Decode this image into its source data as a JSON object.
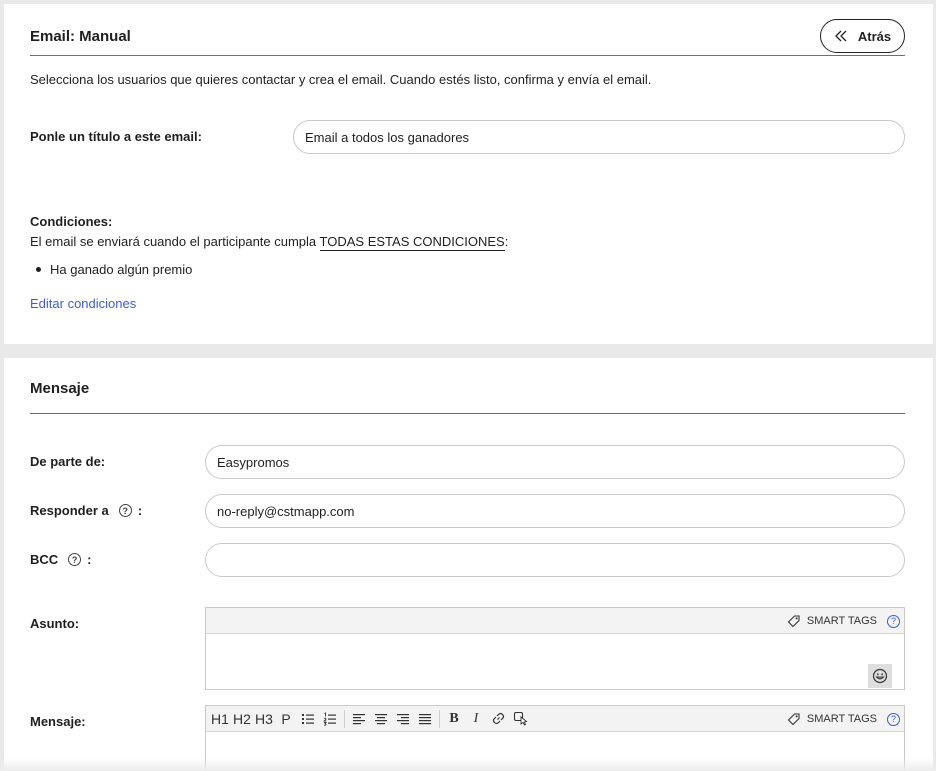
{
  "header": {
    "title": "Email: Manual",
    "back_label": "Atrás"
  },
  "intro": "Selecciona los usuarios que quieres contactar y crea el email. Cuando estés listo, confirma y envía el email.",
  "email_title": {
    "label": "Ponle un título a este email:",
    "value": "Email a todos los ganadores"
  },
  "conditions": {
    "heading": "Condiciones:",
    "sentence_prefix": "El email se enviará cuando el participante cumpla ",
    "sentence_emphasis": "TODAS ESTAS CONDICIONES",
    "sentence_suffix": ":",
    "items": [
      "Ha ganado algún premio"
    ],
    "edit_link": "Editar condiciones"
  },
  "message_section": {
    "title": "Mensaje",
    "from_label": "De parte de:",
    "from_value": "Easypromos",
    "reply_label": "Responder a",
    "reply_value": "no-reply@cstmapp.com",
    "bcc_label": "BCC",
    "bcc_value": "",
    "colon": ":",
    "help_glyph": "?",
    "subject_label": "Asunto:",
    "body_label": "Mensaje:",
    "smart_tags_label": "SMART TAGS",
    "toolbar": [
      "H1",
      "H2",
      "H3",
      "P"
    ],
    "bold_glyph": "B",
    "italic_glyph": "I"
  },
  "colors": {
    "accent": "#3d5fc9",
    "divider": "#6f6f6f",
    "panel_bg": "#ffffff",
    "page_bg": "#e9e9e9"
  }
}
